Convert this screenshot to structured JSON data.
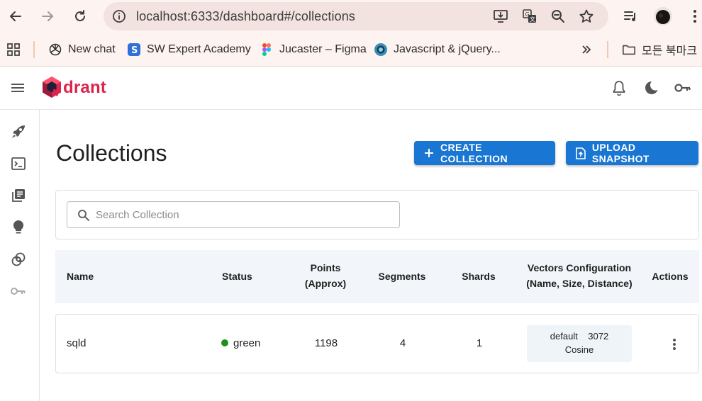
{
  "browser": {
    "url": "localhost:6333/dashboard#/collections",
    "bookmarks": [
      {
        "label": "New chat",
        "icon": "openai-icon"
      },
      {
        "label": "SW Expert Academy",
        "icon": "swea-icon"
      },
      {
        "label": "Jucaster – Figma",
        "icon": "figma-icon"
      },
      {
        "label": "Javascript & jQuery...",
        "icon": "globe-icon"
      }
    ],
    "all_bookmarks_label": "모든 북마크"
  },
  "app": {
    "logo_text": "drant",
    "brand_color": "#dc244c",
    "accent_color": "#1976d2"
  },
  "page": {
    "title": "Collections",
    "create_label": "CREATE COLLECTION",
    "upload_label": "UPLOAD SNAPSHOT",
    "search_placeholder": "Search Collection"
  },
  "table": {
    "headers": {
      "name": "Name",
      "status": "Status",
      "points_1": "Points",
      "points_2": "(Approx)",
      "segments": "Segments",
      "shards": "Shards",
      "vectors_1": "Vectors Configuration",
      "vectors_2": "(Name, Size, Distance)",
      "actions": "Actions"
    },
    "rows": [
      {
        "name": "sqld",
        "status": "green",
        "status_color": "#1e8e1e",
        "points": "1198",
        "segments": "4",
        "shards": "1",
        "vector_name": "default",
        "vector_size": "3072",
        "vector_distance": "Cosine"
      }
    ]
  }
}
